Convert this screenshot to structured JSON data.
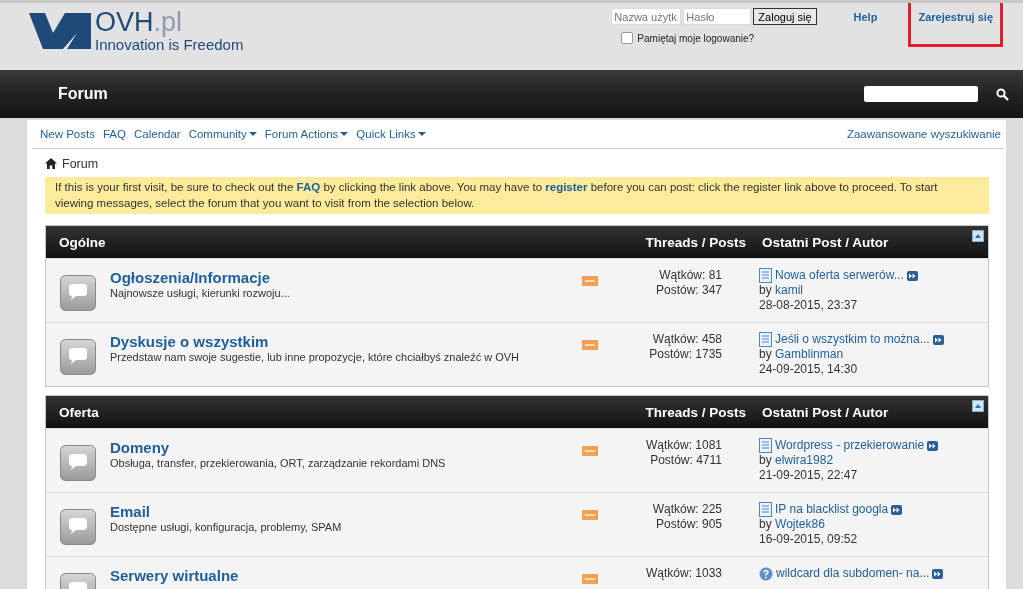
{
  "header": {
    "logo_name": "OVH",
    "logo_suffix": ".pl",
    "tagline": "Innovation is Freedom",
    "login": {
      "username_placeholder": "Nazwa użytk",
      "password_placeholder": "Hasło",
      "button": "Zaloguj się",
      "remember_label": "Pamiętaj moje logowanie?",
      "remember_checked": false
    },
    "links": [
      {
        "label": "Help",
        "highlighted": false
      },
      {
        "label": "Zarejestruj się",
        "highlighted": true
      }
    ]
  },
  "navbar": {
    "title": "Forum"
  },
  "subnav": {
    "items": [
      {
        "label": "New Posts",
        "dropdown": false
      },
      {
        "label": "FAQ",
        "dropdown": false
      },
      {
        "label": "Calendar",
        "dropdown": false
      },
      {
        "label": "Community",
        "dropdown": true
      },
      {
        "label": "Forum Actions",
        "dropdown": true
      },
      {
        "label": "Quick Links",
        "dropdown": true
      }
    ],
    "advanced_search": "Zaawansowane wyszukiwanie"
  },
  "breadcrumb": "Forum",
  "notice": "If this is your first visit, be sure to check out the **FAQ** by clicking the link above. You may have to **register** before you can post: click the register link above to proceed. To start viewing messages, select the forum that you want to visit from the selection below.",
  "sections": [
    {
      "title": "Ogólne",
      "stats_heading": "Threads / Posts",
      "last_heading": "Ostatni Post / Autor",
      "forums": [
        {
          "title": "Ogłoszenia/Informacje",
          "description": "Najnowsze usługi, kierunki rozwoju...",
          "threads": "Wątków: 81",
          "posts": "Postów: 347",
          "last_post": {
            "kind": "document",
            "title": "Nowa oferta serwerów...",
            "by": "by",
            "author": "kamil",
            "date": "28-08-2015, 23:37"
          }
        },
        {
          "title": "Dyskusje o wszystkim",
          "description": "Przedstaw nam swoje sugestie, lub inne propozycje, które chciałbyś znaleźć w OVH",
          "threads": "Wątków: 458",
          "posts": "Postów: 1735",
          "last_post": {
            "kind": "document",
            "title": "Jeśli o wszystkim to można...",
            "by": "by",
            "author": "Gamblinman",
            "date": "24-09-2015, 14:30"
          }
        }
      ]
    },
    {
      "title": "Oferta",
      "stats_heading": "Threads / Posts",
      "last_heading": "Ostatni Post / Autor",
      "forums": [
        {
          "title": "Domeny",
          "description": "Obsługa, transfer, przekierowania, ORT, zarządzanie rekordami DNS",
          "threads": "Wątków: 1081",
          "posts": "Postów: 4711",
          "last_post": {
            "kind": "document",
            "title": "Wordpress - przekierowanie",
            "by": "by",
            "author": "elwira1982",
            "date": "21-09-2015, 22:47"
          }
        },
        {
          "title": "Email",
          "description": "Dostępne usługi, konfiguracja, problemy, SPAM",
          "threads": "Wątków: 225",
          "posts": "Postów: 905",
          "last_post": {
            "kind": "document",
            "title": "IP na blacklist googla",
            "by": "by",
            "author": "Wojtek86",
            "date": "16-09-2015, 09:52"
          }
        },
        {
          "title": "Serwery wirtualne",
          "threads": "Wątków: 1033",
          "last_post": {
            "kind": "question",
            "title": "wildcard dla subdomen- na..."
          }
        }
      ]
    }
  ]
}
